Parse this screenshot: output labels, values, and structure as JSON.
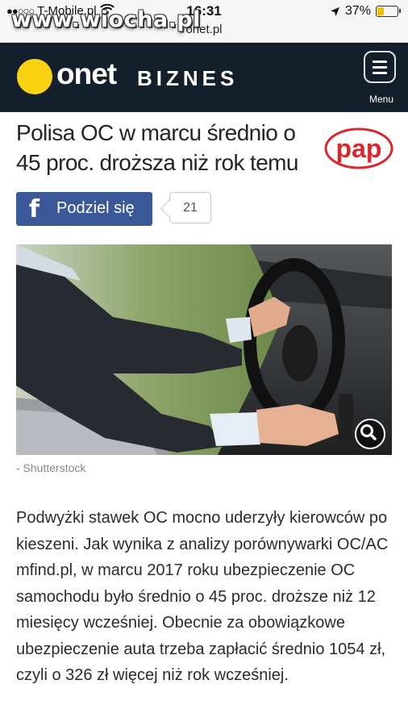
{
  "status_bar": {
    "carrier": "T-Mobile.pl",
    "time": "16:31",
    "url": "onet.pl",
    "battery_percent_label": "37%",
    "battery_level": 0.37,
    "signal_dots": "●●○○○"
  },
  "watermark": "www.wiocha.pl",
  "header": {
    "brand": "onet",
    "section": "BIZNES",
    "menu_label": "Menu",
    "accent_color": "#f9d312",
    "background_color": "#131f2a"
  },
  "article": {
    "title": "Polisa OC w marcu średnio o 45 proc. droższa niż rok temu",
    "source_logo_text": "pap",
    "share_label": "Podziel się",
    "share_count": "21",
    "image_caption": "- Shutterstock",
    "body": "Podwyżki stawek OC mocno uderzyły kierowców po kieszeni. Jak wynika z analizy porównywarki OC/AC mfind.pl, w marcu 2017 roku ubezpieczenie OC samochodu było średnio o 45 proc. droższe niż 12 miesięcy wcześniej. Obecnie za obowiązkowe ubezpieczenie auta trzeba zapłacić średnio 1054 zł, czyli o 326 zł więcej niż rok wcześniej."
  },
  "icons": {
    "location": "location-arrow-icon",
    "wifi": "wifi-icon",
    "menu": "hamburger-menu-icon",
    "facebook": "facebook-icon",
    "zoom": "magnifier-icon"
  }
}
